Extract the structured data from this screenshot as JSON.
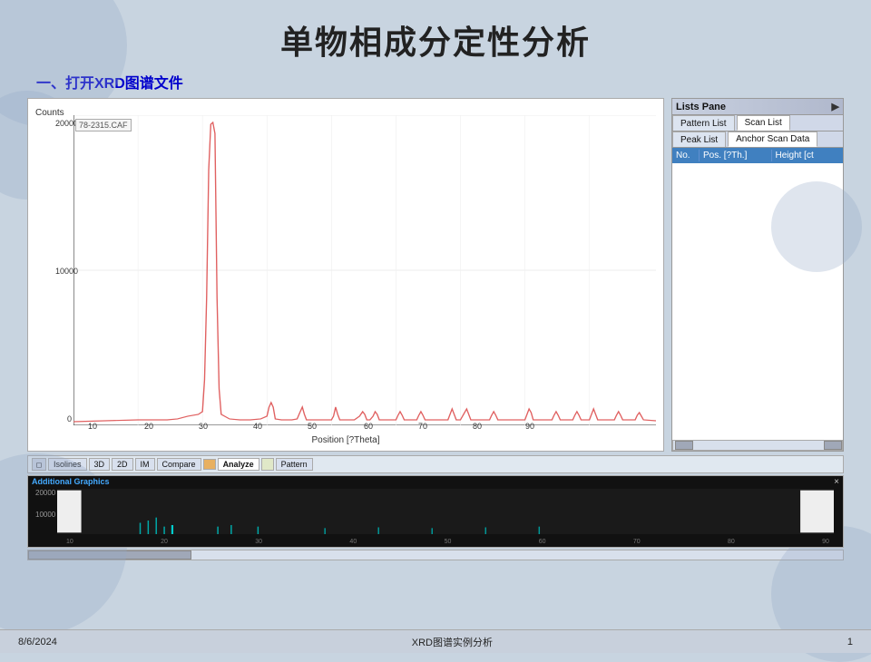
{
  "page": {
    "title": "单物相成分定性分析",
    "subtitle": "一、打开XRD图谱文件",
    "date": "8/6/2024",
    "footer_center": "XRD图谱实例分析",
    "footer_right": "1"
  },
  "lists_pane": {
    "title": "Lists Pane",
    "close_btn": "▶",
    "tab1": "Pattern List",
    "tab2": "Scan List",
    "tab3": "Peak List",
    "tab4": "Anchor Scan Data",
    "col1": "No.",
    "col2": "Pos. [?Th.]",
    "col3": "Height [ct"
  },
  "xrd_chart": {
    "y_label": "Counts",
    "file_label": "78-2315.CAF",
    "x_label": "Position [?Theta]",
    "y_ticks": [
      "20000",
      "10000",
      "0"
    ],
    "x_ticks": [
      "10",
      "20",
      "30",
      "40",
      "50",
      "60",
      "70",
      "80",
      "90"
    ]
  },
  "toolbar": {
    "tabs": [
      "Isolines",
      "3D",
      "2D",
      "IM",
      "Compare",
      "Analyze",
      "Pattern"
    ]
  },
  "additional_graphics": {
    "title": "Additional Graphics",
    "close": "×",
    "y_ticks": [
      "20000",
      "10000"
    ]
  }
}
